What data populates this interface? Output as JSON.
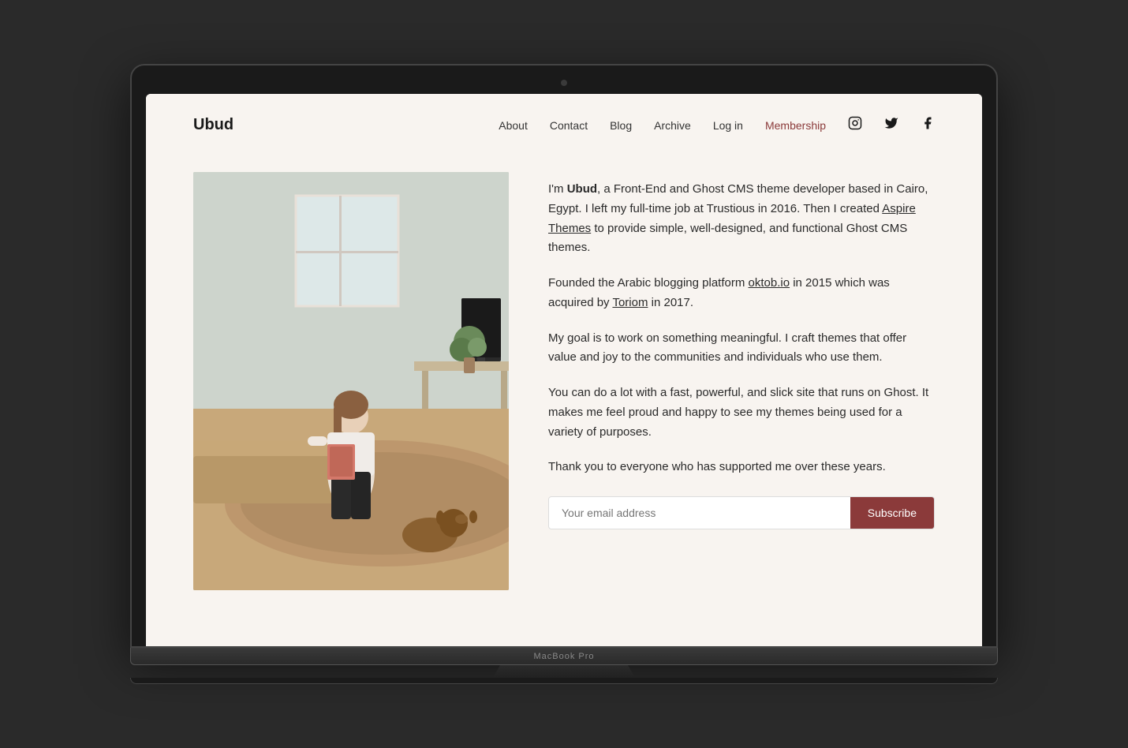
{
  "site": {
    "logo": "Ubud",
    "background_color": "#f8f4f0",
    "accent_color": "#8b3a3a"
  },
  "nav": {
    "links": [
      {
        "label": "About",
        "active": false
      },
      {
        "label": "Contact",
        "active": false
      },
      {
        "label": "Blog",
        "active": false
      },
      {
        "label": "Archive",
        "active": false
      },
      {
        "label": "Log in",
        "active": false
      },
      {
        "label": "Membership",
        "active": true
      }
    ],
    "icons": [
      "instagram",
      "twitter",
      "facebook"
    ]
  },
  "main": {
    "paragraphs": [
      {
        "id": "p1",
        "text_parts": [
          {
            "type": "text",
            "content": "I'm "
          },
          {
            "type": "bold",
            "content": "Ubud"
          },
          {
            "type": "text",
            "content": ", a Front-End and Ghost CMS theme developer based in Cairo, Egypt. I left my full-time job at Trustious in 2016. Then I created "
          },
          {
            "type": "link",
            "content": "Aspire Themes"
          },
          {
            "type": "text",
            "content": " to provide simple, well-designed, and functional Ghost CMS themes."
          }
        ]
      },
      {
        "id": "p2",
        "text_parts": [
          {
            "type": "text",
            "content": "Founded the Arabic blogging platform "
          },
          {
            "type": "link",
            "content": "oktob.io"
          },
          {
            "type": "text",
            "content": " in 2015 which was acquired by "
          },
          {
            "type": "link",
            "content": "Toriom"
          },
          {
            "type": "text",
            "content": " in 2017."
          }
        ]
      },
      {
        "id": "p3",
        "text": "My goal is to work on something meaningful. I craft themes that offer value and joy to the communities and individuals who use them."
      },
      {
        "id": "p4",
        "text": "You can do a lot with a fast, powerful, and slick site that runs on Ghost. It makes me feel proud and happy to see my themes being used for a variety of purposes."
      },
      {
        "id": "p5",
        "text": "Thank you to everyone who has supported me over these years."
      }
    ],
    "subscribe": {
      "placeholder": "Your email address",
      "button_label": "Subscribe"
    }
  },
  "laptop": {
    "model": "MacBook Pro"
  }
}
